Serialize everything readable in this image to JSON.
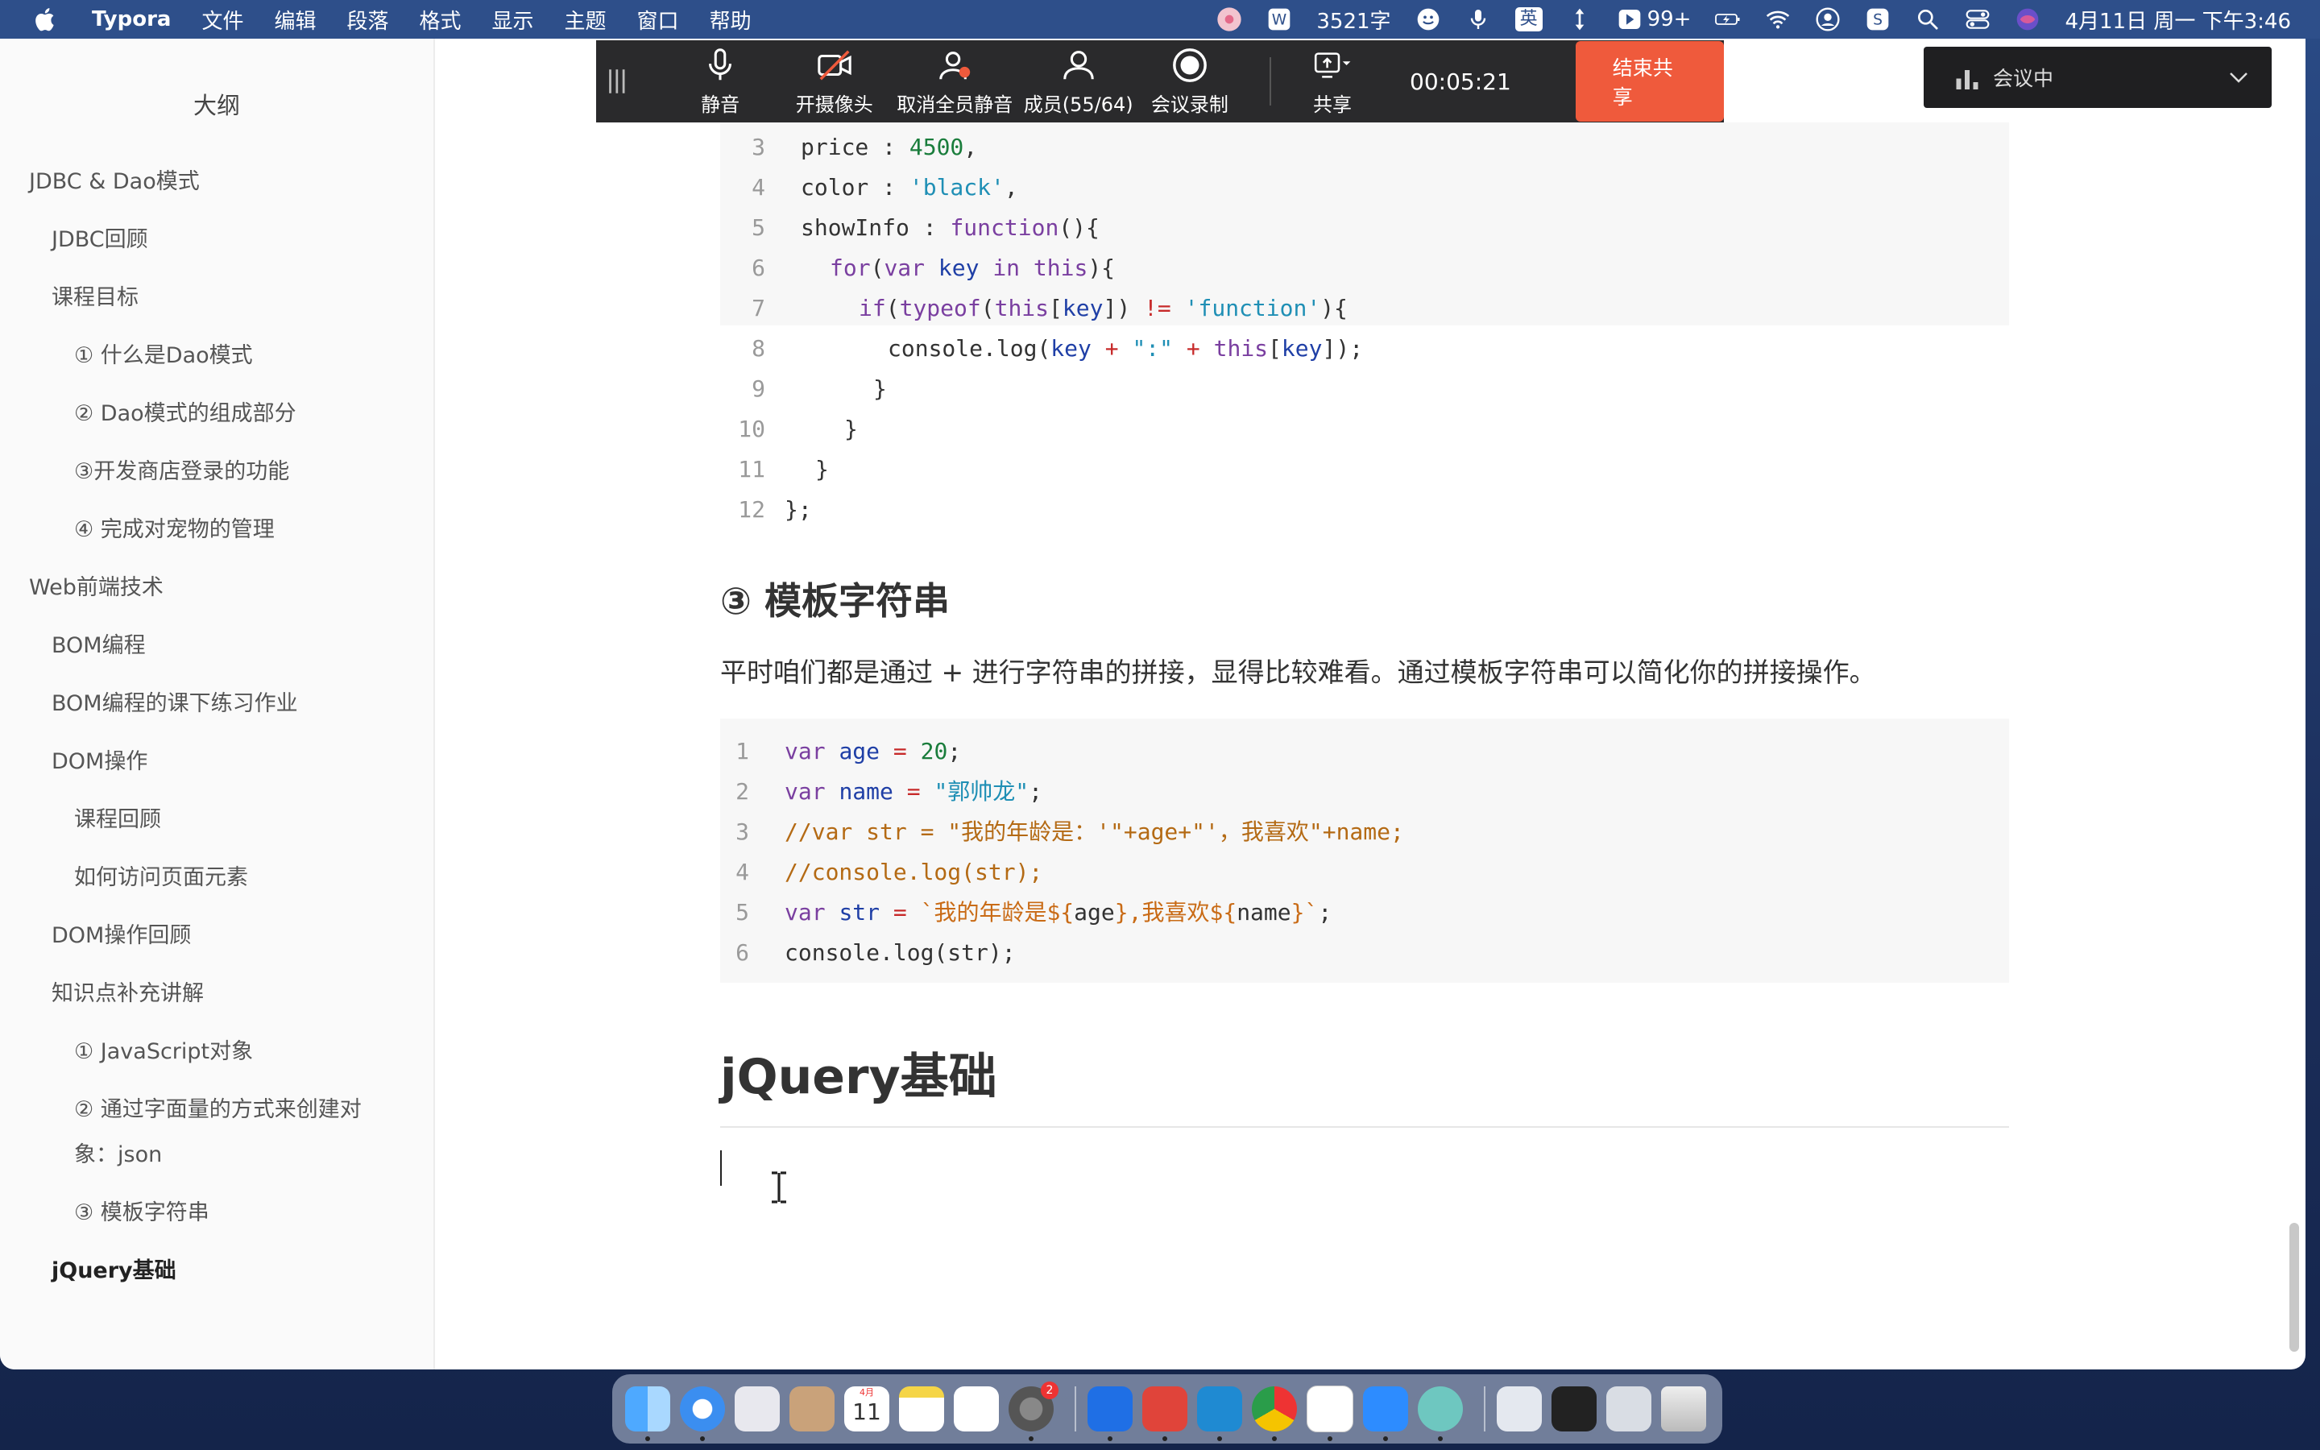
{
  "menubar": {
    "app_name": "Typora",
    "menus": [
      "文件",
      "编辑",
      "段落",
      "格式",
      "显示",
      "主题",
      "窗口",
      "帮助"
    ],
    "word_count": "3521字",
    "input_lang": "英",
    "notification_count": "99+",
    "clock": "4月11日 周一 下午3:46"
  },
  "sidebar": {
    "title": "大纲",
    "items": [
      {
        "label": "JDBC & Dao模式",
        "level": 1
      },
      {
        "label": "JDBC回顾",
        "level": 2
      },
      {
        "label": "课程目标",
        "level": 2
      },
      {
        "label": "① 什么是Dao模式",
        "level": 3
      },
      {
        "label": "② Dao模式的组成部分",
        "level": 3
      },
      {
        "label": "③开发商店登录的功能",
        "level": 3
      },
      {
        "label": "④ 完成对宠物的管理",
        "level": 3
      },
      {
        "label": "Web前端技术",
        "level": 1
      },
      {
        "label": "BOM编程",
        "level": 2
      },
      {
        "label": "BOM编程的课下练习作业",
        "level": 2
      },
      {
        "label": "DOM操作",
        "level": 2
      },
      {
        "label": "课程回顾",
        "level": 3
      },
      {
        "label": "如何访问页面元素",
        "level": 3
      },
      {
        "label": "DOM操作回顾",
        "level": 2
      },
      {
        "label": "知识点补充讲解",
        "level": 2
      },
      {
        "label": "① JavaScript对象",
        "level": 3
      },
      {
        "label": "② 通过字面量的方式来创建对象：json",
        "level": 3
      },
      {
        "label": "③ 模板字符串",
        "level": 3
      },
      {
        "label": "jQuery基础",
        "level": 2
      }
    ]
  },
  "editor": {
    "code1": {
      "line_numbers": [
        "3",
        "4",
        "5",
        "6",
        "7",
        "8",
        "9",
        "10",
        "11",
        "12"
      ],
      "lines": [
        "price : 4500,",
        "color : 'black',",
        "showInfo : function(){",
        "  for(var key in this){",
        "    if(typeof(this[key]) != 'function'){",
        "      console.log(key + \":\" + this[key]);",
        "    }",
        "  }",
        "}",
        "};"
      ]
    },
    "heading": "③ 模板字符串",
    "paragraph": "平时咱们都是通过 + 进行字符串的拼接，显得比较难看。通过模板字符串可以简化你的拼接操作。",
    "code2": {
      "line_numbers": [
        "1",
        "2",
        "3",
        "4",
        "5",
        "6"
      ],
      "lines": [
        "var age = 20;",
        "var name = \"郭帅龙\";",
        "//var str = \"我的年龄是：'\"+age+\"'，我喜欢\"+name;",
        "//console.log(str);",
        "var str = `我的年龄是${age},我喜欢${name}`;",
        "console.log(str);"
      ]
    },
    "h1": "jQuery基础"
  },
  "meeting_bar": {
    "buttons": [
      {
        "label": "静音",
        "icon": "microphone-icon"
      },
      {
        "label": "开摄像头",
        "icon": "camera-off-icon"
      },
      {
        "label": "取消全员静音",
        "icon": "unmute-all-icon"
      },
      {
        "label": "成员(55/64)",
        "icon": "members-icon"
      },
      {
        "label": "会议录制",
        "icon": "record-icon"
      }
    ],
    "share_label": "共享",
    "timer": "00:05:21",
    "end_share_label": "结束共享",
    "status_label": "会议中",
    "end_button_color": "#ef5a3c"
  },
  "dock": {
    "calendar_month": "4月",
    "calendar_day": "11",
    "settings_badge": "2"
  }
}
